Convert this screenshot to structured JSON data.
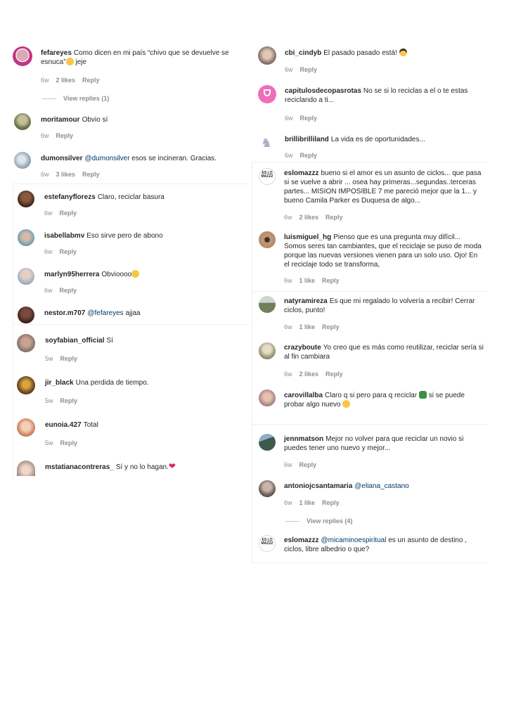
{
  "left": [
    {
      "user": "fefareyes",
      "text": "Como dicen en mi país “chivo que se devuelve se esnuca”",
      "tail": " jeje",
      "time": "6w",
      "likes": "2 likes",
      "reply": "Reply",
      "view": "View replies (1)"
    },
    {
      "user": "moritamour",
      "text": "Obvio sí",
      "time": "6w",
      "reply": "Reply"
    },
    {
      "user": "dumonsilver",
      "mention": "@dumonsilver",
      "text": " esos se incineran. Gracias.",
      "time": "6w",
      "likes": "3 likes",
      "reply": "Reply"
    },
    {
      "user": "estefanyflorezs",
      "text": "Claro, reciclar basura",
      "time": "6w",
      "reply": "Reply"
    },
    {
      "user": "isabellabmv",
      "text": "Eso sirve pero de abono",
      "time": "6w",
      "reply": "Reply"
    },
    {
      "user": "marlyn95herrera",
      "text": "Obvioooo",
      "time": "6w",
      "reply": "Reply"
    },
    {
      "user": "nestor.m707",
      "mention": "@fefareyes",
      "text": " ajjaa"
    },
    {
      "user": "soyfabian_official",
      "text": "Sí",
      "time": "5w",
      "reply": "Reply"
    },
    {
      "user": "jir_black",
      "text": "Una perdida de tiempo.",
      "time": "5w",
      "reply": "Reply"
    },
    {
      "user": "eunoia.427",
      "text": "Total",
      "time": "5w",
      "reply": "Reply"
    },
    {
      "user": "mstatianacontreras_",
      "text": "Sí y no lo hagan."
    }
  ],
  "right": [
    {
      "user": "cbi_cindyb",
      "text": "El pasado pasado está!",
      "time": "6w",
      "reply": "Reply"
    },
    {
      "user": "capitulosdecopasrotas",
      "text": "No se si lo reciclas a el o te estas reciclando a ti...",
      "time": "6w",
      "reply": "Reply"
    },
    {
      "user": "brillibrilliland",
      "text": "La vida es de oportunidades...",
      "time": "6w",
      "reply": "Reply"
    },
    {
      "user": "eslomazzz",
      "text": "bueno si el amor es un asunto de ciclos... que pasa si se vuelve a abrir ... osea hay primeras...segundas..terceras partes... MISION IMPOSIBLE 7 me pareció mejor que la 1... y bueno Camila Parker es Duquesa de algo...",
      "time": "6w",
      "likes": "2 likes",
      "reply": "Reply"
    },
    {
      "user": "luismiguel_hg",
      "text": "Pienso que es una pregunta muy difícil... Somos seres tan cambiantes, que el reciclaje se puso de moda porque las nuevas versiones vienen para un solo uso. Ojo! En el reciclaje todo se transforma,",
      "time": "6w",
      "likes": "1 like",
      "reply": "Reply"
    },
    {
      "user": "natyramireza",
      "text": "Es que mi regalado lo volvería a recibir! Cerrar ciclos, punto!",
      "time": "6w",
      "likes": "1 like",
      "reply": "Reply"
    },
    {
      "user": "crazyboute",
      "text": "Yo creo que es más como reutilizar, reciclar sería si al fin cambiara",
      "time": "6w",
      "likes": "2 likes",
      "reply": "Reply"
    },
    {
      "user": "carovillalba",
      "text": "Claro q si pero para q reciclar",
      "tail": " si se puede probar algo nuevo"
    },
    {
      "user": "jennmatson",
      "text": "Mejor no volver para que reciclar un novio si puedes tener uno nuevo y mejor...",
      "time": "6w",
      "reply": "Reply"
    },
    {
      "user": "antoniojcsantamaria",
      "mention": "@eliana_castano",
      "text": "",
      "time": "6w",
      "likes": "1 like",
      "reply": "Reply",
      "view": "View replies (4)"
    },
    {
      "user": "eslomazzz",
      "mention": "@micaminoespiritual",
      "text": " es un asunto de destino , ciclos, libre albedrio o que?"
    }
  ],
  "logo_text": "ES LO MAZZZ"
}
